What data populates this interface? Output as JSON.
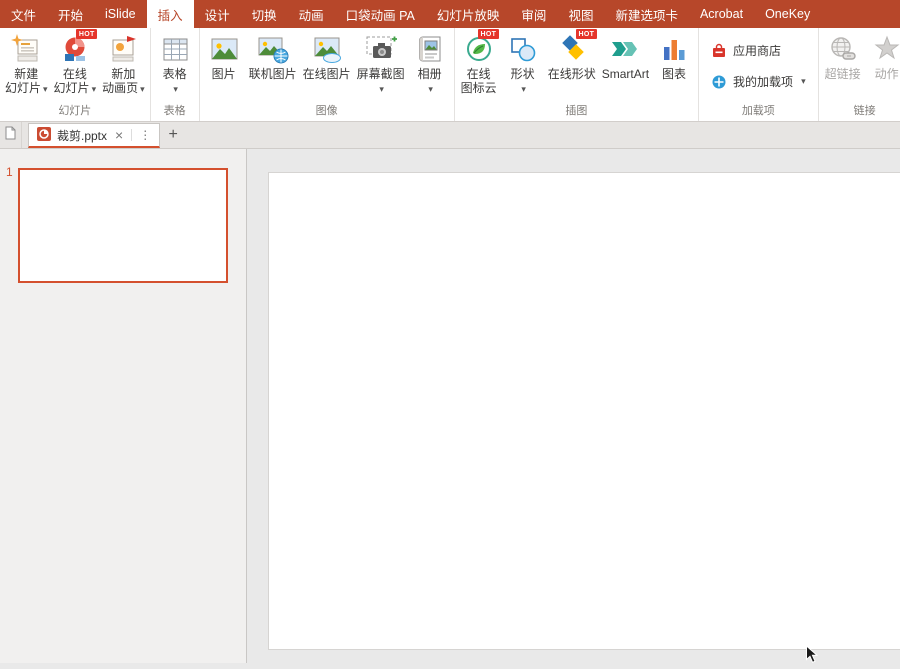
{
  "glyphs": {
    "dropdown": "▾",
    "close": "×",
    "tab_menu": "⋮",
    "add_tab": "+",
    "hot": "HOT"
  },
  "colors": {
    "accent_red": "#b7472a",
    "hot_badge": "#e5352b",
    "slide_border": "#d4502e",
    "disabled_text": "#a8a6a4"
  },
  "menubar": {
    "items": [
      {
        "label": "文件"
      },
      {
        "label": "开始"
      },
      {
        "label": "iSlide"
      },
      {
        "label": "插入",
        "active": true
      },
      {
        "label": "设计"
      },
      {
        "label": "切换"
      },
      {
        "label": "动画"
      },
      {
        "label": "口袋动画 PA"
      },
      {
        "label": "幻灯片放映"
      },
      {
        "label": "审阅"
      },
      {
        "label": "视图"
      },
      {
        "label": "新建选项卡"
      },
      {
        "label": "Acrobat"
      },
      {
        "label": "OneKey"
      }
    ]
  },
  "ribbon": {
    "groups": [
      {
        "label": "幻灯片",
        "buttons": [
          {
            "line1": "新建",
            "line2": "幻灯片",
            "dropdown": true,
            "icon": "new-slide-icon"
          },
          {
            "line1": "在线",
            "line2": "幻灯片",
            "dropdown": true,
            "hot": true,
            "icon": "online-slide-icon"
          },
          {
            "line1": "新加",
            "line2": "动画页",
            "dropdown": true,
            "icon": "new-animation-page-icon"
          }
        ]
      },
      {
        "label": "表格",
        "buttons": [
          {
            "line1": "表格",
            "dropdown": true,
            "icon": "table-icon"
          }
        ]
      },
      {
        "label": "图像",
        "buttons": [
          {
            "line1": "图片",
            "icon": "picture-icon"
          },
          {
            "line1": "联机图片",
            "icon": "online-pictures-icon"
          },
          {
            "line1": "在线图片",
            "icon": "online-picture-icon"
          },
          {
            "line1": "屏幕截图",
            "dropdown": true,
            "icon": "screenshot-icon"
          },
          {
            "line1": "相册",
            "dropdown": true,
            "icon": "photo-album-icon"
          }
        ]
      },
      {
        "label": "插图",
        "buttons": [
          {
            "line1": "在线",
            "line2": "图标云",
            "hot": true,
            "icon": "online-icon-cloud-icon"
          },
          {
            "line1": "形状",
            "dropdown": true,
            "icon": "shapes-icon"
          },
          {
            "line1": "在线形状",
            "hot": true,
            "icon": "online-shapes-icon"
          },
          {
            "line1": "SmartArt",
            "icon": "smartart-icon"
          },
          {
            "line1": "图表",
            "icon": "chart-icon"
          }
        ]
      },
      {
        "label": "加载项",
        "buttons": [
          {
            "line1": "应用商店",
            "icon": "app-store-icon",
            "small": true
          },
          {
            "line1": "我的加载项",
            "dropdown": true,
            "icon": "my-addins-icon",
            "small": true
          }
        ]
      },
      {
        "label": "链接",
        "buttons": [
          {
            "line1": "超链接",
            "icon": "hyperlink-icon",
            "disabled": true
          },
          {
            "line1": "动作",
            "icon": "action-icon",
            "disabled": true
          }
        ]
      }
    ]
  },
  "tabbar": {
    "tabs": [
      {
        "title": "裁剪.pptx",
        "active": true
      }
    ]
  },
  "slides_panel": {
    "slides": [
      {
        "number": "1"
      }
    ]
  }
}
